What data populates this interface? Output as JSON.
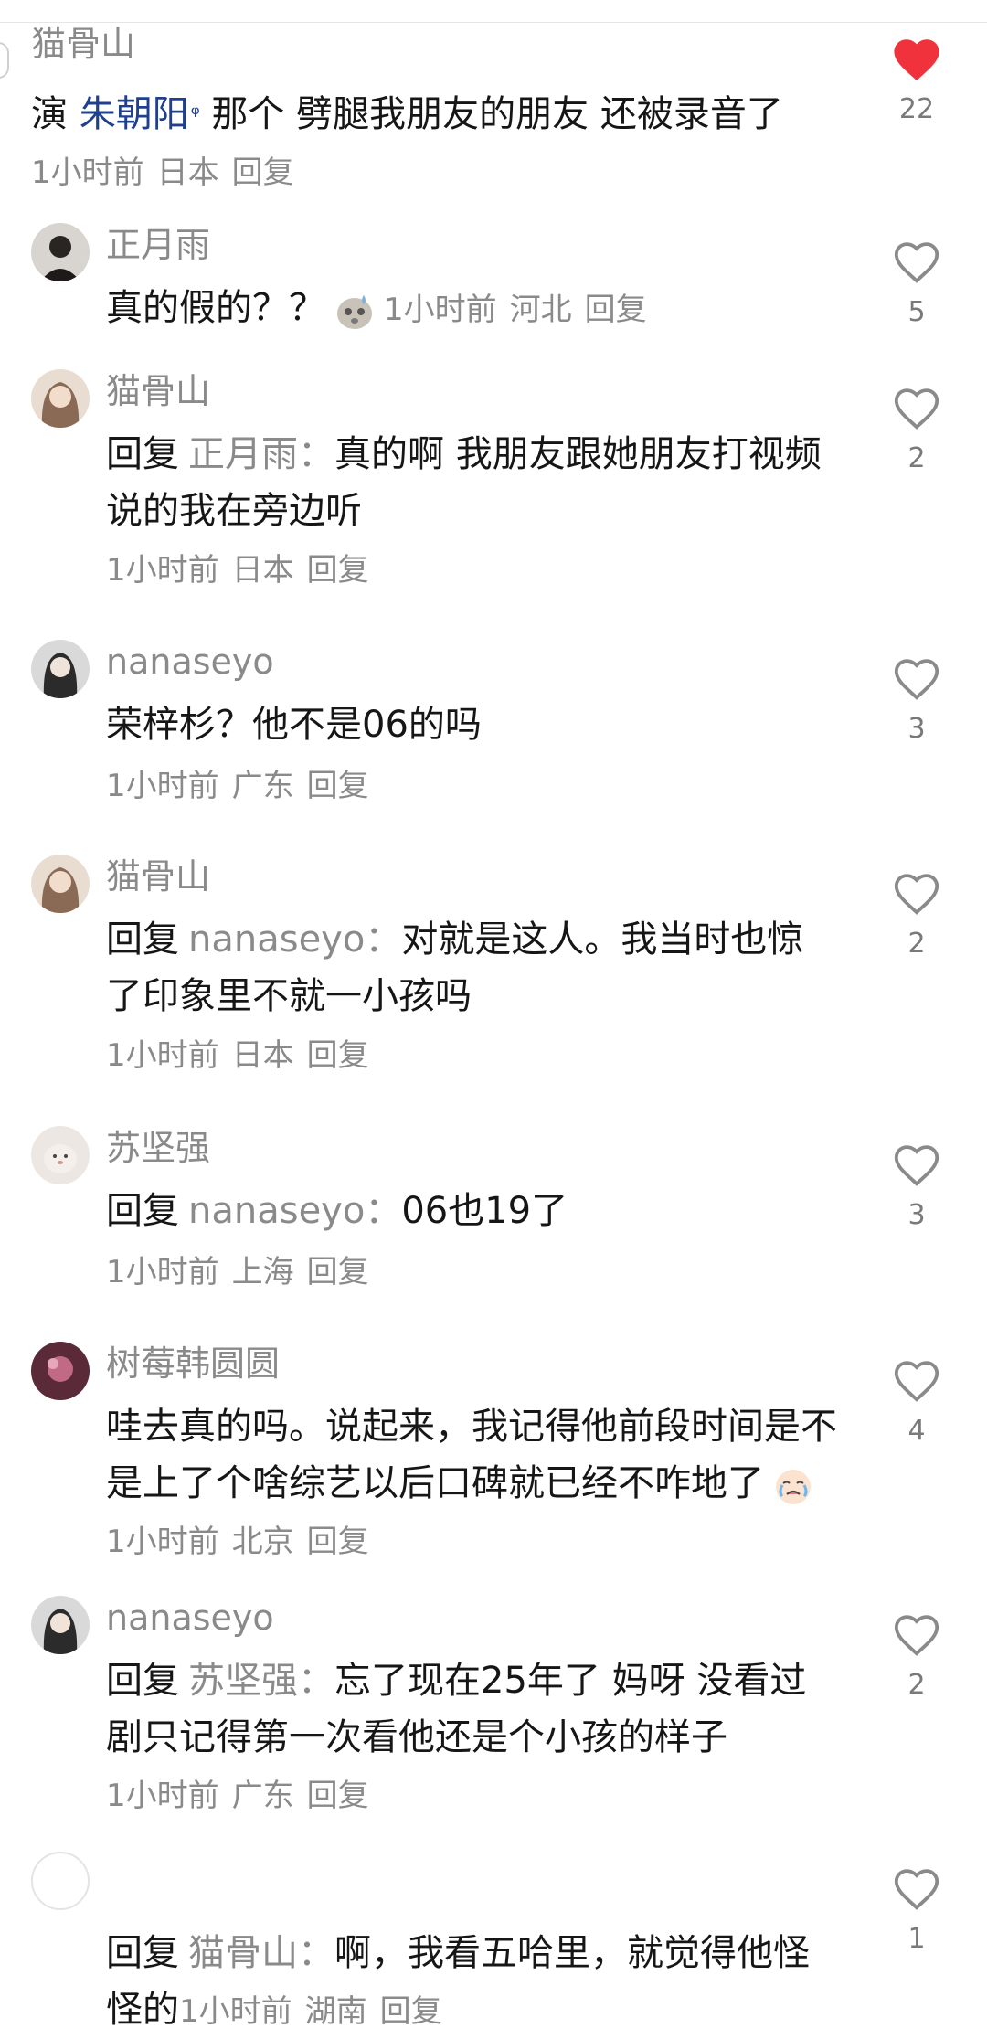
{
  "comments": [
    {
      "username": "猫骨山",
      "text_before": "演 ",
      "link_text": "朱朝阳",
      "link_glyph": "ᵠ",
      "text_after": " 那个 劈腿我朋友的朋友 还被录音了",
      "time": "1小时前",
      "location": "日本",
      "reply_label": "回复",
      "likes": "22",
      "liked": true
    },
    {
      "username": "正月雨",
      "text": "真的假的？？",
      "emoji": "sweat-face-emoji",
      "time": "1小时前",
      "location": "河北",
      "reply_label": "回复",
      "likes": "5"
    },
    {
      "username": "猫骨山",
      "reply_prefix": "回复",
      "reply_target": "正月雨：",
      "text": "真的啊 我朋友跟她朋友打视频说的我在旁边听",
      "time": "1小时前",
      "location": "日本",
      "reply_label": "回复",
      "likes": "2"
    },
    {
      "username": "nanaseyo",
      "text": "荣梓杉？他不是06的吗",
      "time": "1小时前",
      "location": "广东",
      "reply_label": "回复",
      "likes": "3"
    },
    {
      "username": "猫骨山",
      "reply_prefix": "回复",
      "reply_target": "nanaseyo：",
      "text": "对就是这人。我当时也惊了印象里不就一小孩吗",
      "time": "1小时前",
      "location": "日本",
      "reply_label": "回复",
      "likes": "2"
    },
    {
      "username": "苏坚强",
      "reply_prefix": "回复",
      "reply_target": "nanaseyo：",
      "text": "06也19了",
      "time": "1小时前",
      "location": "上海",
      "reply_label": "回复",
      "likes": "3"
    },
    {
      "username": "树莓韩圆圆",
      "text": "哇去真的吗。说起来，我记得他前段时间是不是上了个啥综艺以后口碑就已经不咋地了",
      "emoji": "crying-face-emoji",
      "time": "1小时前",
      "location": "北京",
      "reply_label": "回复",
      "likes": "4"
    },
    {
      "username": "nanaseyo",
      "reply_prefix": "回复",
      "reply_target": "苏坚强：",
      "text": "忘了现在25年了 妈呀 没看过剧只记得第一次看他还是个小孩的样子",
      "time": "1小时前",
      "location": "广东",
      "reply_label": "回复",
      "likes": "2"
    },
    {
      "username": "",
      "reply_prefix": "回复",
      "reply_target": "猫骨山：",
      "text": "啊，我看五哈里，就觉得他怪怪的",
      "time": "1小时前",
      "location": "湖南",
      "reply_label": "回复",
      "likes": "1"
    }
  ],
  "colors": {
    "like_active": "#f0323c",
    "like_outline": "#8a8a8a",
    "username": "#8a8a8a",
    "link": "#1f3f8f"
  }
}
